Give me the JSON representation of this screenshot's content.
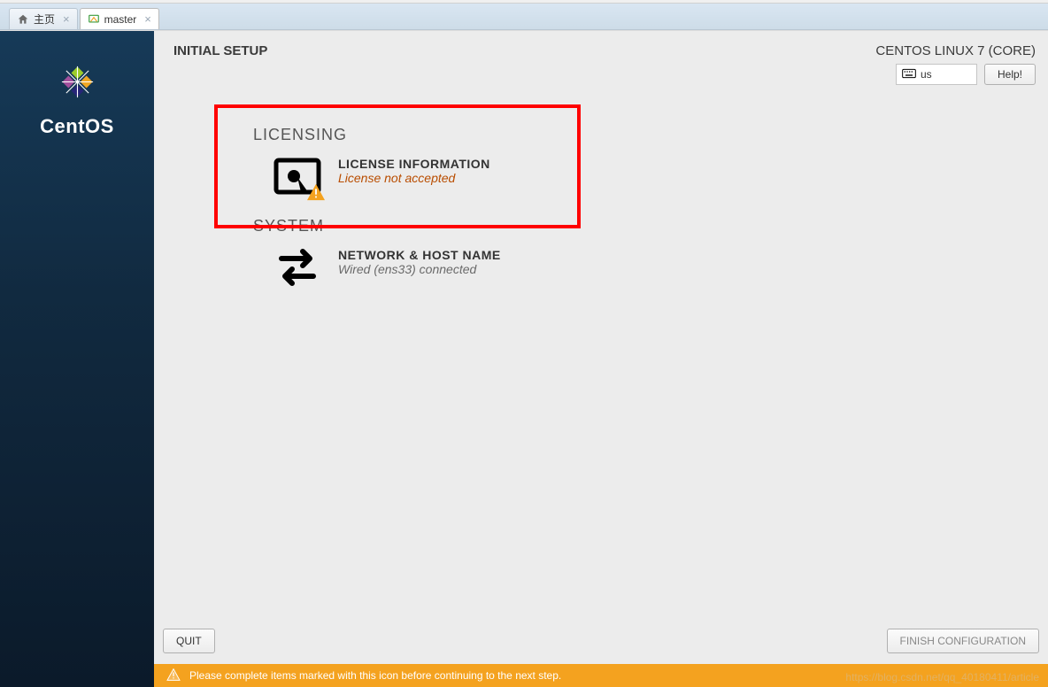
{
  "tabs": {
    "home_label": "主页",
    "vm_label": "master"
  },
  "sidebar": {
    "logo_name": "CentOS"
  },
  "header": {
    "title": "INITIAL SETUP",
    "os_name": "CENTOS LINUX 7 (CORE)",
    "keyboard": "us",
    "help_label": "Help!"
  },
  "sections": {
    "licensing": {
      "title": "LICENSING",
      "spoke_title": "LICENSE INFORMATION",
      "spoke_sub": "License not accepted"
    },
    "system": {
      "title": "SYSTEM",
      "spoke_title": "NETWORK & HOST NAME",
      "spoke_sub": "Wired (ens33) connected"
    }
  },
  "footer": {
    "quit_label": "QUIT",
    "finish_label": "FINISH CONFIGURATION"
  },
  "warning_bar": {
    "message": "Please complete items marked with this icon before continuing to the next step."
  },
  "watermark": "https://blog.csdn.net/qq_40180411/article"
}
